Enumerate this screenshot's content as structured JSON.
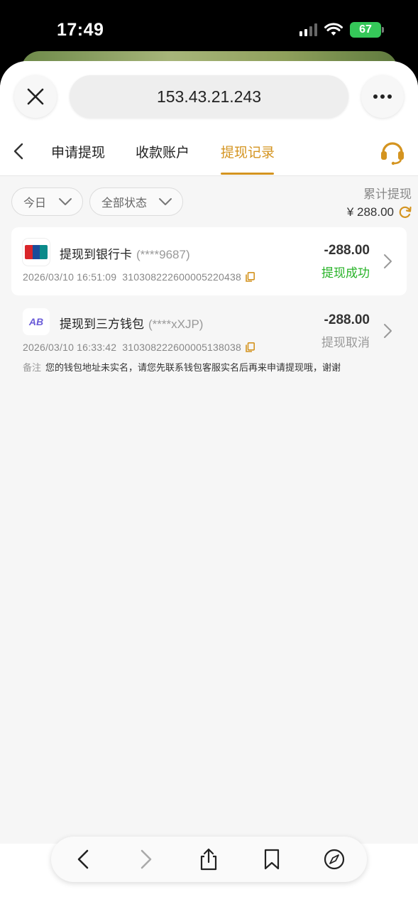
{
  "status_bar": {
    "time": "17:49",
    "battery": "67"
  },
  "browser": {
    "url": "153.43.21.243"
  },
  "tabs": [
    {
      "label": "申请提现"
    },
    {
      "label": "收款账户"
    },
    {
      "label": "提现记录"
    }
  ],
  "filters": {
    "date": "今日",
    "status": "全部状态"
  },
  "summary": {
    "label": "累计提现",
    "amount": "¥ 288.00"
  },
  "records": [
    {
      "title": "提现到银行卡",
      "account": "(****9687)",
      "time": "2026/03/10 16:51:09",
      "order_no": "310308222600005220438",
      "amount": "-288.00",
      "status": "提现成功",
      "status_color": "#27b327",
      "logo": "unionpay-icon",
      "logo_text": "UnionPay 银联"
    },
    {
      "title": "提现到三方钱包",
      "account": "(****xXJP)",
      "time": "2026/03/10 16:33:42",
      "order_no": "310308222600005138038",
      "amount": "-288.00",
      "status": "提现取消",
      "status_color": "#999999",
      "logo": "abpay-icon",
      "logo_text": "AB pay",
      "note_label": "备注",
      "note": "您的钱包地址未实名，请您先联系钱包客服实名后再来申请提现哦，谢谢"
    }
  ],
  "colors": {
    "accent": "#d49420",
    "success": "#27b327"
  }
}
